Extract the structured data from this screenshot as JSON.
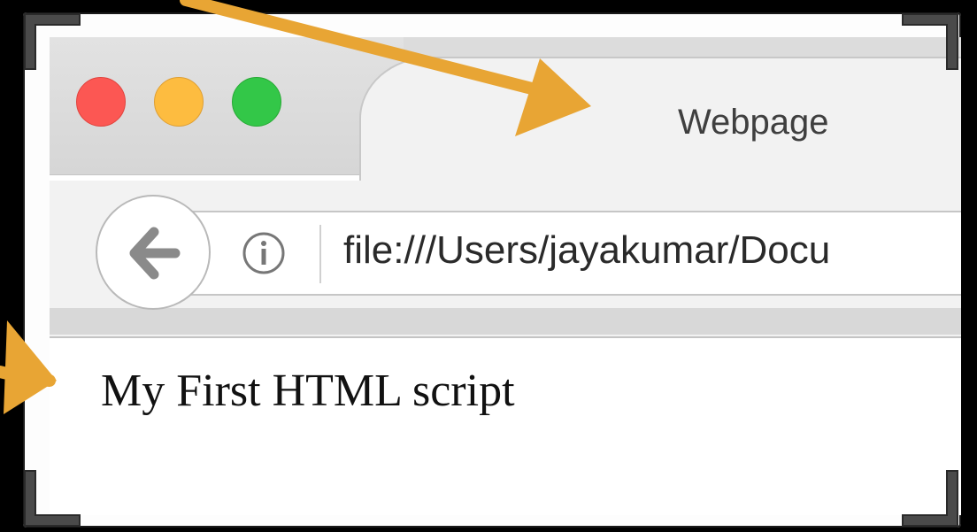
{
  "window": {
    "tab_title": "Webpage",
    "traffic_lights": {
      "close": {
        "icon": "close-dot-icon",
        "color": "#fc5753"
      },
      "minimize": {
        "icon": "minimize-dot-icon",
        "color": "#fdbc40"
      },
      "maximize": {
        "icon": "maximize-dot-icon",
        "color": "#33c748"
      }
    }
  },
  "toolbar": {
    "back_icon": "back-arrow-icon",
    "info_icon": "info-icon",
    "url": "file:///Users/jayakumar/Docu"
  },
  "page": {
    "body_text": "My First HTML script"
  },
  "annotations": {
    "arrow_color": "#e8a534"
  }
}
